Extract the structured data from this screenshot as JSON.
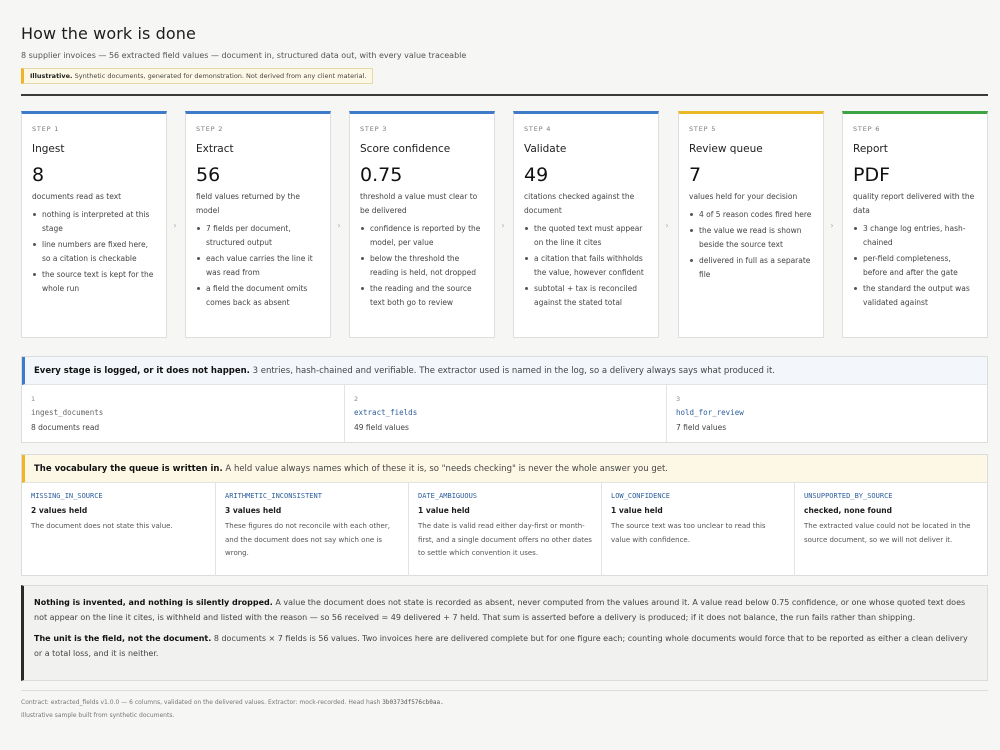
{
  "header": {
    "title": "How the work is done",
    "subtitle": "8 supplier invoices — 56 extracted field values — document in, structured data out, with every value traceable",
    "notice_strong": "Illustrative.",
    "notice_text": "Synthetic documents, generated for demonstration. Not derived from any client material."
  },
  "steps": [
    {
      "label": "STEP 1",
      "name": "Ingest",
      "big": "8",
      "desc": "documents read as text",
      "bullets": [
        "nothing is interpreted at this stage",
        "line numbers are fixed here, so a citation is checkable",
        "the source text is kept for the whole run"
      ]
    },
    {
      "label": "STEP 2",
      "name": "Extract",
      "big": "56",
      "desc": "field values returned by the model",
      "bullets": [
        "7 fields per document, structured output",
        "each value carries the line it was read from",
        "a field the document omits comes back as absent"
      ]
    },
    {
      "label": "STEP 3",
      "name": "Score confidence",
      "big": "0.75",
      "desc": "threshold a value must clear to be delivered",
      "bullets": [
        "confidence is reported by the model, per value",
        "below the threshold the reading is held, not dropped",
        "the reading and the source text both go to review"
      ]
    },
    {
      "label": "STEP 4",
      "name": "Validate",
      "big": "49",
      "desc": "citations checked against the document",
      "bullets": [
        "the quoted text must appear on the line it cites",
        "a citation that fails withholds the value, however confident",
        "subtotal + tax is reconciled against the stated total"
      ]
    },
    {
      "label": "STEP 5",
      "name": "Review queue",
      "big": "7",
      "desc": "values held for your decision",
      "bullets": [
        "4 of 5 reason codes fired here",
        "the value we read is shown beside the source text",
        "delivered in full as a separate file"
      ]
    },
    {
      "label": "STEP 6",
      "name": "Report",
      "big": "PDF",
      "desc": "quality report delivered with the data",
      "bullets": [
        "3 change log entries, hash-chained",
        "per-field completeness, before and after the gate",
        "the standard the output was validated against"
      ]
    }
  ],
  "chevron": "›",
  "log": {
    "heading_strong": "Every stage is logged, or it does not happen.",
    "heading_text": "3 entries, hash-chained and verifiable. The extractor used is named in the log, so a delivery always says what produced it.",
    "entries": [
      {
        "num": "1",
        "fn": "ingest_documents",
        "desc": "8 documents read"
      },
      {
        "num": "2",
        "fn": "extract_fields",
        "desc": "49 field values"
      },
      {
        "num": "3",
        "fn": "hold_for_review",
        "desc": "7 field values"
      }
    ]
  },
  "vocab": {
    "heading_strong": "The vocabulary the queue is written in.",
    "heading_text": "A held value always names which of these it is, so \"needs checking\" is never the whole answer you get.",
    "codes": [
      {
        "code": "MISSING_IN_SOURCE",
        "count": "2 values held",
        "desc": "The document does not state this value."
      },
      {
        "code": "ARITHMETIC_INCONSISTENT",
        "count": "3 values held",
        "desc": "These figures do not reconcile with each other, and the document does not say which one is wrong."
      },
      {
        "code": "DATE_AMBIGUOUS",
        "count": "1 value held",
        "desc": "The date is valid read either day-first or month-first, and a single document offers no other dates to settle which convention it uses."
      },
      {
        "code": "LOW_CONFIDENCE",
        "count": "1 value held",
        "desc": "The source text was too unclear to read this value with confidence."
      },
      {
        "code": "UNSUPPORTED_BY_SOURCE",
        "count": "checked, none found",
        "desc": "The extracted value could not be located in the source document, so we will not deliver it."
      }
    ]
  },
  "callout": {
    "p1_strong": "Nothing is invented, and nothing is silently dropped.",
    "p1_text": "A value the document does not state is recorded as absent, never computed from the values around it. A value read below 0.75 confidence, or one whose quoted text does not appear on the line it cites, is withheld and listed with the reason — so 56 received = 49 delivered + 7 held. That sum is asserted before a delivery is produced; if it does not balance, the run fails rather than shipping.",
    "p2_strong": "The unit is the field, not the document.",
    "p2_text": "8 documents × 7 fields is 56 values. Two invoices here are delivered complete but for one figure each; counting whole documents would force that to be reported as either a clean delivery or a total loss, and it is neither."
  },
  "footer": {
    "line1_text": "Contract: extracted_fields v1.0.0 — 6 columns, validated on the delivered values. Extractor: mock-recorded. Head hash",
    "head_hash": "3b0373df576cb0aa.",
    "line2": "Illustrative sample built from synthetic documents."
  }
}
